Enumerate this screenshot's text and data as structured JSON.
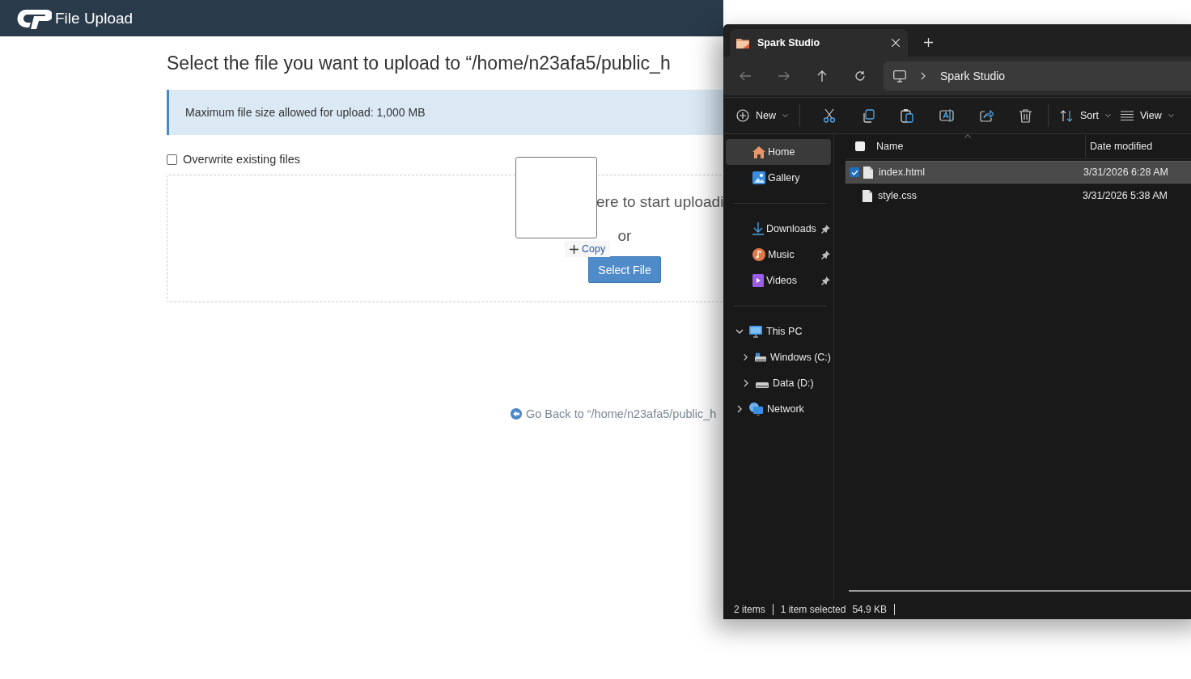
{
  "header": {
    "title": "File Upload"
  },
  "upload": {
    "heading": "Select the file you want to upload to “/home/n23afa5/public_h",
    "notice": "Maximum file size allowed for upload: 1,000 MB",
    "overwrite": {
      "label": "Overwrite existing files",
      "checked": false
    },
    "drop_text": "ere to start uploadi",
    "or_text": "or",
    "select_button": "Select File",
    "drag_badge": "Copy",
    "back_link": "Go Back to “/home/n23afa5/public_h"
  },
  "explorer": {
    "tabs": [
      {
        "title": "Spark Studio",
        "selected": true
      }
    ],
    "location": "Spark Studio",
    "toolbar": {
      "new_label": "New",
      "sort_label": "Sort",
      "view_label": "View"
    },
    "sidebar": {
      "quick": [
        {
          "label": "Home",
          "selected": true
        },
        {
          "label": "Gallery",
          "selected": false
        }
      ],
      "pinned": [
        {
          "label": "Downloads",
          "pinned": true
        },
        {
          "label": "Music",
          "pinned": true
        },
        {
          "label": "Videos",
          "pinned": true
        }
      ],
      "tree": [
        {
          "label": "This PC",
          "expanded": true,
          "children": [
            {
              "label": "Windows (C:)",
              "expanded": false
            },
            {
              "label": "Data (D:)",
              "expanded": false
            }
          ]
        },
        {
          "label": "Network",
          "expanded": false
        }
      ]
    },
    "columns": [
      "Name",
      "Date modified"
    ],
    "select_all_checked": false,
    "files": [
      {
        "name": "index.html",
        "date": "3/31/2026 6:28 AM",
        "selected": true
      },
      {
        "name": "style.css",
        "date": "3/31/2026 5:38 AM",
        "selected": false
      }
    ],
    "status": {
      "count": "2 items",
      "selection": "1 item selected",
      "size": "54.9 KB"
    }
  }
}
